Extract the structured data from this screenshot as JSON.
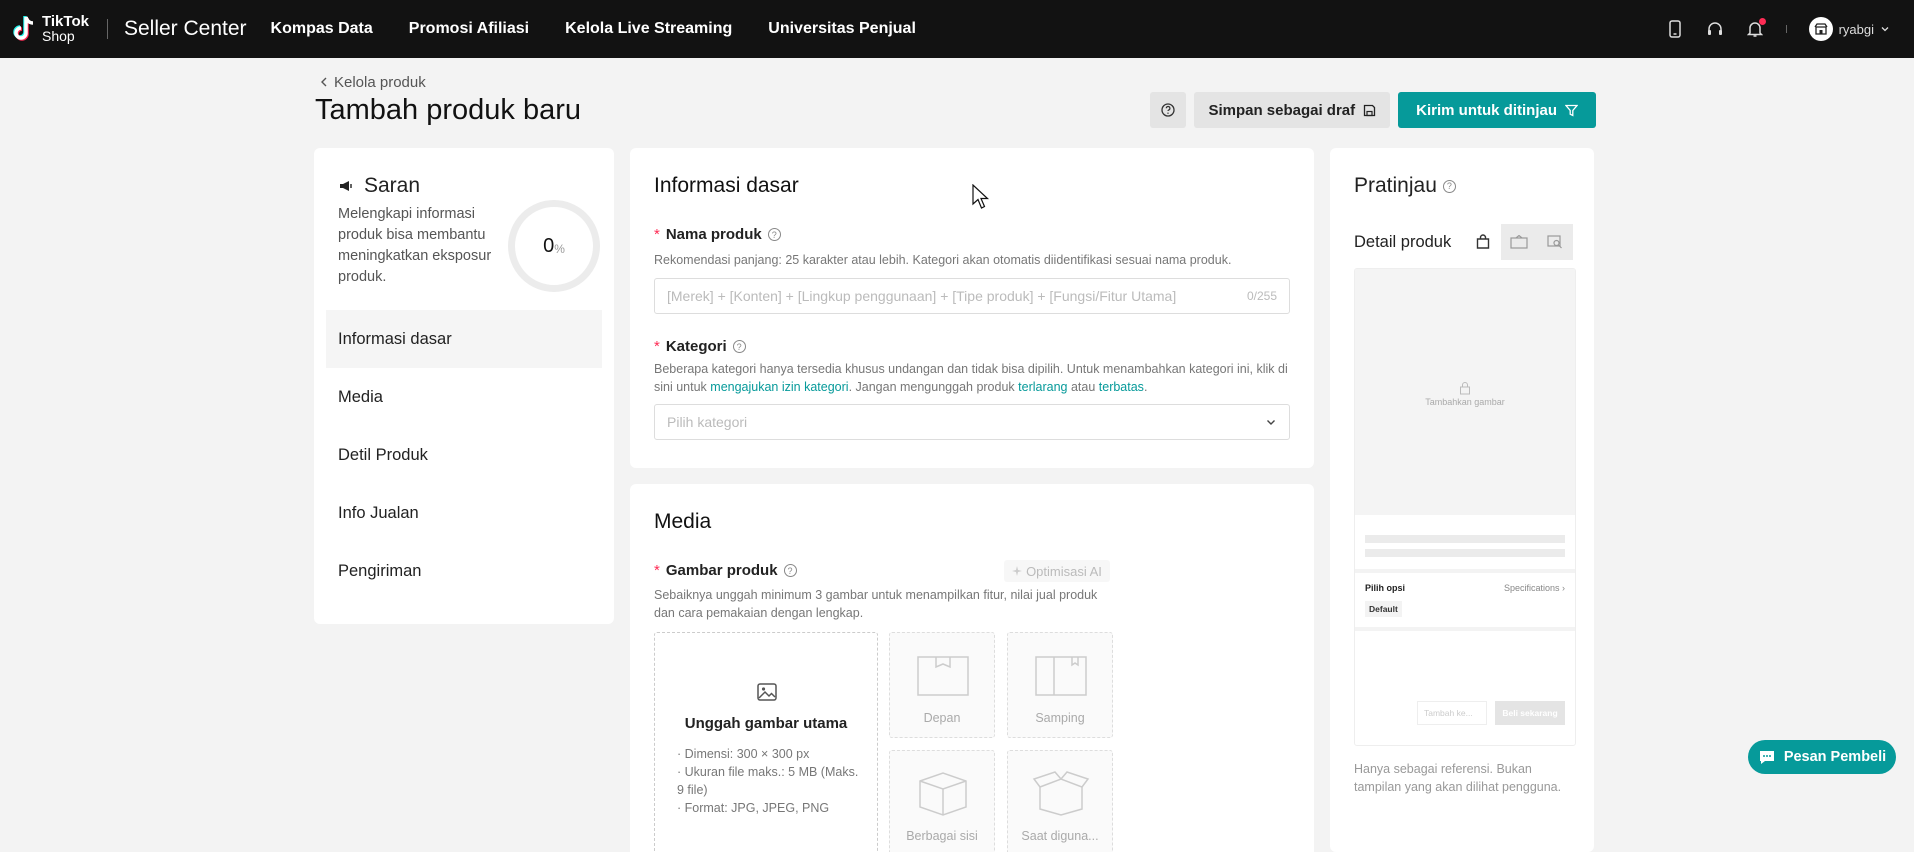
{
  "topbar": {
    "logo_line1": "TikTok",
    "logo_line2": "Shop",
    "brand": "Seller Center",
    "nav": [
      "Kompas Data",
      "Promosi Afiliasi",
      "Kelola Live Streaming",
      "Universitas Penjual"
    ],
    "username": "ryabgi"
  },
  "header": {
    "breadcrumb": "Kelola produk",
    "title": "Tambah produk baru",
    "draft_label": "Simpan sebagai draf",
    "submit_label": "Kirim untuk ditinjau"
  },
  "saran": {
    "title": "Saran",
    "description": "Melengkapi informasi produk bisa membantu meningkatkan eksposur produk.",
    "progress_value": "0",
    "progress_unit": "%",
    "sections": [
      "Informasi dasar",
      "Media",
      "Detil Produk",
      "Info Jualan",
      "Pengiriman"
    ]
  },
  "basic_info": {
    "title": "Informasi dasar",
    "name_label": "Nama produk",
    "name_hint": "Rekomendasi panjang: 25 karakter atau lebih. Kategori akan otomatis diidentifikasi sesuai nama produk.",
    "name_placeholder": "[Merek] + [Konten] + [Lingkup penggunaan] + [Tipe produk] + [Fungsi/Fitur Utama]",
    "name_counter": "0/255",
    "category_label": "Kategori",
    "category_hint_1": "Beberapa kategori hanya tersedia khusus undangan dan tidak bisa dipilih. Untuk menambahkan kategori ini, klik di sini untuk ",
    "category_link_1": "mengajukan izin kategori",
    "category_hint_2": ". Jangan mengunggah produk ",
    "category_link_2": "terlarang",
    "category_hint_3": " atau ",
    "category_link_3": "terbatas",
    "category_hint_4": ".",
    "category_placeholder": "Pilih kategori"
  },
  "media": {
    "title": "Media",
    "image_label": "Gambar produk",
    "ai_label": "Optimisasi AI",
    "image_hint": "Sebaiknya unggah minimum 3 gambar untuk menampilkan fitur, nilai jual produk dan cara pemakaian dengan lengkap.",
    "upload_title": "Unggah gambar utama",
    "spec_dimension": "· Dimensi: 300 × 300 px",
    "spec_size": "· Ukuran file maks.: 5 MB (Maks. 9 file)",
    "spec_format": "· Format: JPG, JPEG, PNG",
    "slots": [
      "Depan",
      "Samping",
      "Berbagai sisi",
      "Saat diguna..."
    ]
  },
  "preview": {
    "title": "Pratinjau",
    "detail_label": "Detail produk",
    "add_photo": "Tambahkan gambar",
    "option_title": "Pilih opsi",
    "spec_link": "Specifications",
    "default_option": "Default",
    "cart_placeholder": "Tambah ke...",
    "buy_label": "Beli sekarang",
    "note": "Hanya sebagai referensi. Bukan tampilan yang akan dilihat pengguna."
  },
  "chat": {
    "label": "Pesan Pembeli"
  },
  "colors": {
    "accent": "#069a9a",
    "topbar": "#121212",
    "required": "#fe2c55"
  }
}
